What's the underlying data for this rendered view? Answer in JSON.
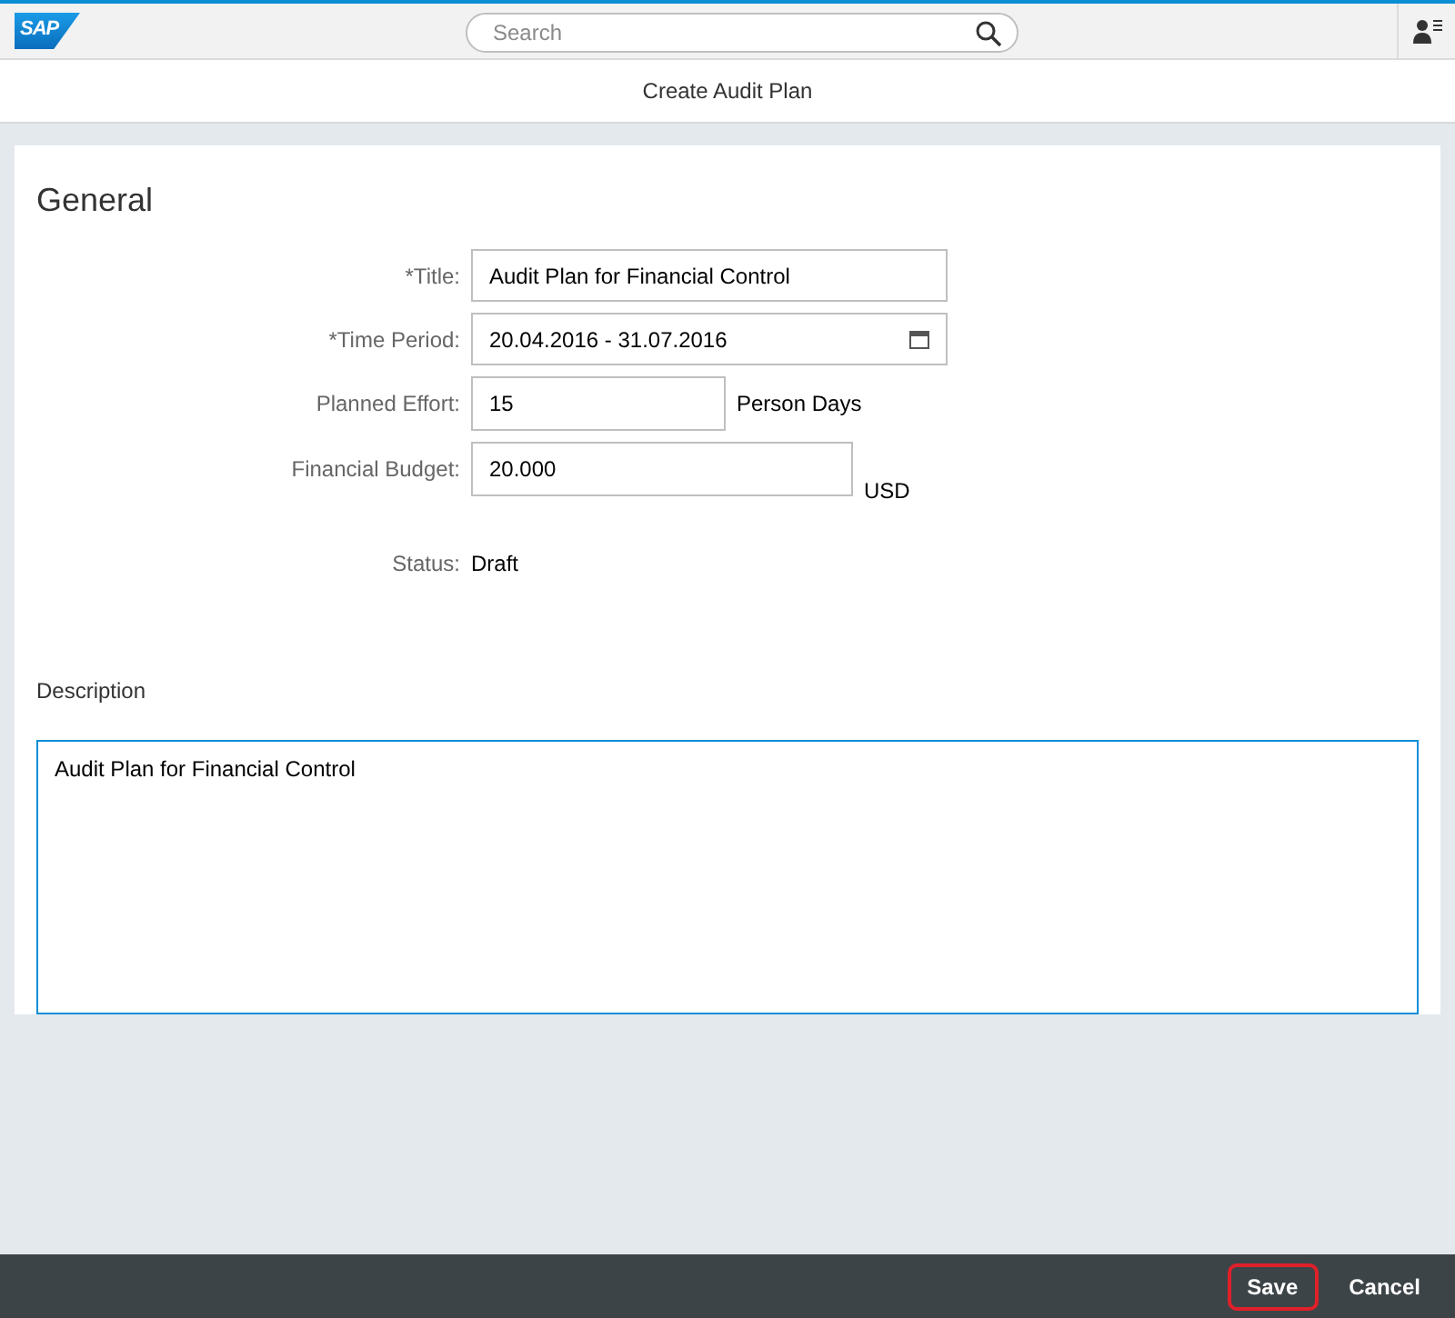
{
  "header": {
    "logo": "SAP",
    "search": {
      "placeholder": "Search"
    }
  },
  "page_title": "Create Audit Plan",
  "section_title": "General",
  "fields": [
    {
      "kind": "text",
      "label": "*Title:",
      "value": "Audit Plan for Financial Control"
    },
    {
      "kind": "date",
      "label": "*Time Period:",
      "value": "20.04.2016 - 31.07.2016"
    },
    {
      "kind": "unit",
      "label": "Planned Effort:",
      "value": "15",
      "unit": "Person Days"
    },
    {
      "kind": "unit-low",
      "label": "Financial Budget:",
      "value": "20.000",
      "unit": "USD"
    },
    {
      "kind": "readonly",
      "label": "Status:",
      "value": "Draft"
    }
  ],
  "description": {
    "label": "Description",
    "value": "Audit Plan for Financial Control"
  },
  "footer_buttons": [
    {
      "label": "Save",
      "highlighted": true
    },
    {
      "label": "Cancel",
      "highlighted": false
    }
  ]
}
